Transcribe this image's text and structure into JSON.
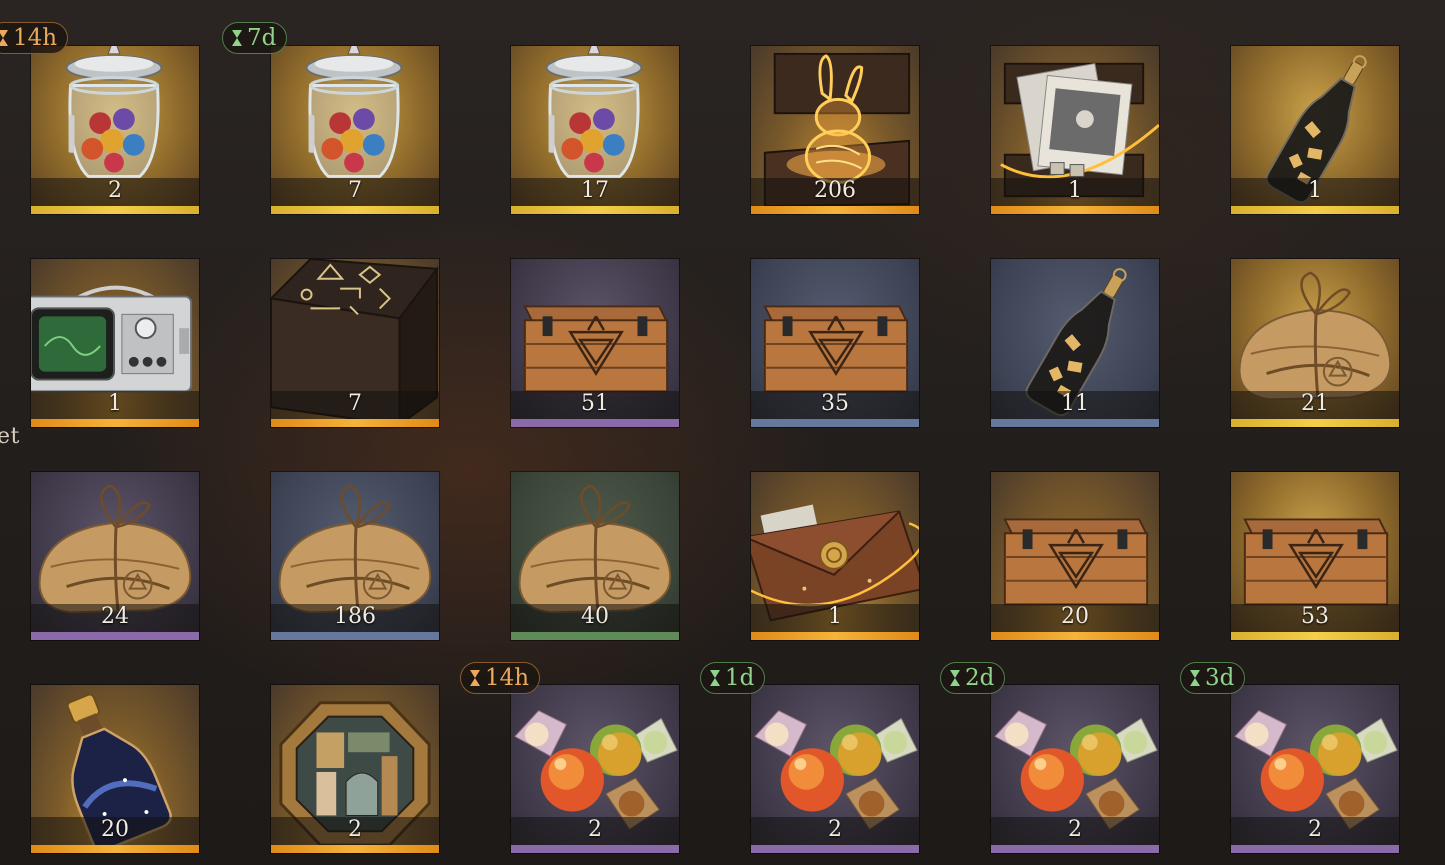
{
  "sidebar_fragment": "et",
  "items": [
    {
      "name": "marble-jar",
      "count": "2",
      "rarity": "gold",
      "timer": "14h",
      "timer_color": "orange"
    },
    {
      "name": "marble-jar",
      "count": "7",
      "rarity": "gold",
      "timer": "7d",
      "timer_color": "green"
    },
    {
      "name": "marble-jar",
      "count": "17",
      "rarity": "gold"
    },
    {
      "name": "golden-rabbit-chest",
      "count": "206",
      "rarity": "orange"
    },
    {
      "name": "photo-chest",
      "count": "1",
      "rarity": "orange"
    },
    {
      "name": "message-bottle",
      "count": "1",
      "rarity": "gold"
    },
    {
      "name": "vintage-tv",
      "count": "1",
      "rarity": "orange"
    },
    {
      "name": "rune-table",
      "count": "7",
      "rarity": "orange"
    },
    {
      "name": "wooden-crate",
      "count": "51",
      "rarity": "purple"
    },
    {
      "name": "wooden-crate",
      "count": "35",
      "rarity": "blue"
    },
    {
      "name": "message-bottle",
      "count": "11",
      "rarity": "blue"
    },
    {
      "name": "wrapped-parcel",
      "count": "21",
      "rarity": "gold"
    },
    {
      "name": "wrapped-parcel",
      "count": "24",
      "rarity": "purple"
    },
    {
      "name": "wrapped-parcel",
      "count": "186",
      "rarity": "blue"
    },
    {
      "name": "wrapped-parcel",
      "count": "40",
      "rarity": "green"
    },
    {
      "name": "sealed-envelope",
      "count": "1",
      "rarity": "orange"
    },
    {
      "name": "wooden-crate",
      "count": "20",
      "rarity": "orange"
    },
    {
      "name": "wooden-crate",
      "count": "53",
      "rarity": "gold"
    },
    {
      "name": "starry-potion",
      "count": "20",
      "rarity": "orange"
    },
    {
      "name": "puzzle-box",
      "count": "2",
      "rarity": "orange"
    },
    {
      "name": "candy",
      "count": "2",
      "rarity": "purple",
      "timer": "14h",
      "timer_color": "orange"
    },
    {
      "name": "candy",
      "count": "2",
      "rarity": "purple",
      "timer": "1d",
      "timer_color": "green"
    },
    {
      "name": "candy",
      "count": "2",
      "rarity": "purple",
      "timer": "2d",
      "timer_color": "green"
    },
    {
      "name": "candy",
      "count": "2",
      "rarity": "purple",
      "timer": "3d",
      "timer_color": "green"
    }
  ]
}
